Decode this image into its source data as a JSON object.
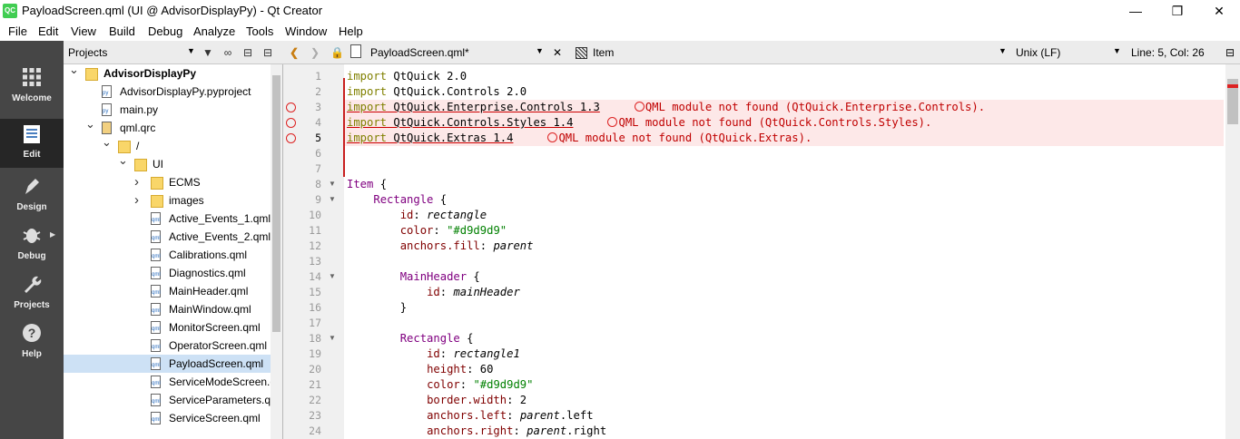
{
  "window": {
    "title": "PayloadScreen.qml (UI @ AdvisorDisplayPy) - Qt Creator",
    "app_icon": "QC"
  },
  "menu": [
    "File",
    "Edit",
    "View",
    "Build",
    "Debug",
    "Analyze",
    "Tools",
    "Window",
    "Help"
  ],
  "modes": [
    {
      "label": "Welcome",
      "icon": "grid-icon"
    },
    {
      "label": "Edit",
      "icon": "document-icon"
    },
    {
      "label": "Design",
      "icon": "pen-icon"
    },
    {
      "label": "Debug",
      "icon": "bug-icon"
    },
    {
      "label": "Projects",
      "icon": "wrench-icon"
    },
    {
      "label": "Help",
      "icon": "help-icon"
    }
  ],
  "projects": {
    "title": "Projects",
    "tree": [
      {
        "label": "AdvisorDisplayPy",
        "kind": "project-folder",
        "expanded": true
      },
      {
        "label": "AdvisorDisplayPy.pyproject",
        "kind": "py-file"
      },
      {
        "label": "main.py",
        "kind": "py-file"
      },
      {
        "label": "qml.qrc",
        "kind": "qrc-file",
        "expanded": true
      },
      {
        "label": "/",
        "kind": "folder",
        "expanded": true
      },
      {
        "label": "UI",
        "kind": "folder",
        "expanded": true
      },
      {
        "label": "ECMS",
        "kind": "folder",
        "expanded": false
      },
      {
        "label": "images",
        "kind": "folder",
        "expanded": false
      },
      {
        "label": "Active_Events_1.qml",
        "kind": "qml-file"
      },
      {
        "label": "Active_Events_2.qml",
        "kind": "qml-file"
      },
      {
        "label": "Calibrations.qml",
        "kind": "qml-file"
      },
      {
        "label": "Diagnostics.qml",
        "kind": "qml-file"
      },
      {
        "label": "MainHeader.qml",
        "kind": "qml-file"
      },
      {
        "label": "MainWindow.qml",
        "kind": "qml-file"
      },
      {
        "label": "MonitorScreen.qml",
        "kind": "qml-file"
      },
      {
        "label": "OperatorScreen.qml",
        "kind": "qml-file"
      },
      {
        "label": "PayloadScreen.qml",
        "kind": "qml-file",
        "selected": true
      },
      {
        "label": "ServiceModeScreen.qml",
        "kind": "qml-file"
      },
      {
        "label": "ServiceParameters.qml",
        "kind": "qml-file"
      },
      {
        "label": "ServiceScreen.qml",
        "kind": "qml-file"
      }
    ]
  },
  "editor_toolbar": {
    "file": "PayloadScreen.qml*",
    "symbol": "Item",
    "line_ending": "Unix (LF)",
    "cursor": "Line: 5, Col: 26"
  },
  "code": {
    "current_line": 5,
    "lines": [
      [
        [
          "kw",
          "import"
        ],
        [
          "",
          "",
          " QtQuick 2.0"
        ]
      ],
      [
        [
          "kw",
          "import"
        ],
        [
          "",
          "",
          " QtQuick.Controls 2.0"
        ]
      ],
      [
        [
          "kw",
          "import"
        ],
        [
          "",
          "",
          " QtQuick.Enterprise.Controls 1.3"
        ]
      ],
      [
        [
          "kw",
          "import"
        ],
        [
          "",
          "",
          " QtQuick.Controls.Styles 1.4"
        ]
      ],
      [
        [
          "kw",
          "import"
        ],
        [
          "",
          "",
          " QtQuick.Extras 1.4"
        ]
      ],
      [],
      [],
      [
        [
          "ty",
          "Item"
        ],
        [
          "",
          "",
          " {"
        ]
      ],
      [
        [
          "",
          "",
          "    "
        ],
        [
          "ty",
          "Rectangle"
        ],
        [
          "",
          "",
          " {"
        ]
      ],
      [
        [
          "",
          "",
          "        "
        ],
        [
          "pr",
          "id"
        ],
        [
          "",
          "",
          ": "
        ],
        [
          "it",
          "rectangle"
        ]
      ],
      [
        [
          "",
          "",
          "        "
        ],
        [
          "pr",
          "color"
        ],
        [
          "",
          "",
          ": "
        ],
        [
          "st",
          "\"#d9d9d9\""
        ]
      ],
      [
        [
          "",
          "",
          "        "
        ],
        [
          "pr",
          "anchors.fill"
        ],
        [
          "",
          "",
          ": "
        ],
        [
          "it",
          "parent"
        ]
      ],
      [],
      [
        [
          "",
          "",
          "        "
        ],
        [
          "ty",
          "MainHeader"
        ],
        [
          "",
          "",
          " {"
        ]
      ],
      [
        [
          "",
          "",
          "            "
        ],
        [
          "pr",
          "id"
        ],
        [
          "",
          "",
          ": "
        ],
        [
          "it",
          "mainHeader"
        ]
      ],
      [
        [
          "",
          "",
          "        }"
        ]
      ],
      [],
      [
        [
          "",
          "",
          "        "
        ],
        [
          "ty",
          "Rectangle"
        ],
        [
          "",
          "",
          " {"
        ]
      ],
      [
        [
          "",
          "",
          "            "
        ],
        [
          "pr",
          "id"
        ],
        [
          "",
          "",
          ": "
        ],
        [
          "it",
          "rectangle1"
        ]
      ],
      [
        [
          "",
          "",
          "            "
        ],
        [
          "pr",
          "height"
        ],
        [
          "",
          "",
          ": 60"
        ]
      ],
      [
        [
          "",
          "",
          "            "
        ],
        [
          "pr",
          "color"
        ],
        [
          "",
          "",
          ": "
        ],
        [
          "st",
          "\"#d9d9d9\""
        ]
      ],
      [
        [
          "",
          "",
          "            "
        ],
        [
          "pr",
          "border.width"
        ],
        [
          "",
          "",
          ": 2"
        ]
      ],
      [
        [
          "",
          "",
          "            "
        ],
        [
          "pr",
          "anchors.left"
        ],
        [
          "",
          "",
          ": "
        ],
        [
          "it",
          "parent"
        ],
        [
          "",
          "",
          ".left"
        ]
      ],
      [
        [
          "",
          "",
          "            "
        ],
        [
          "pr",
          "anchors.right"
        ],
        [
          "",
          "",
          ": "
        ],
        [
          "it",
          "parent"
        ],
        [
          "",
          "",
          ".right"
        ]
      ]
    ],
    "errors": [
      {
        "line": 3,
        "message": "QML module not found (QtQuick.Enterprise.Controls)."
      },
      {
        "line": 4,
        "message": "QML module not found (QtQuick.Controls.Styles)."
      },
      {
        "line": 5,
        "message": "QML module not found (QtQuick.Extras)."
      }
    ],
    "fold_lines": [
      8,
      9,
      14,
      18
    ]
  }
}
